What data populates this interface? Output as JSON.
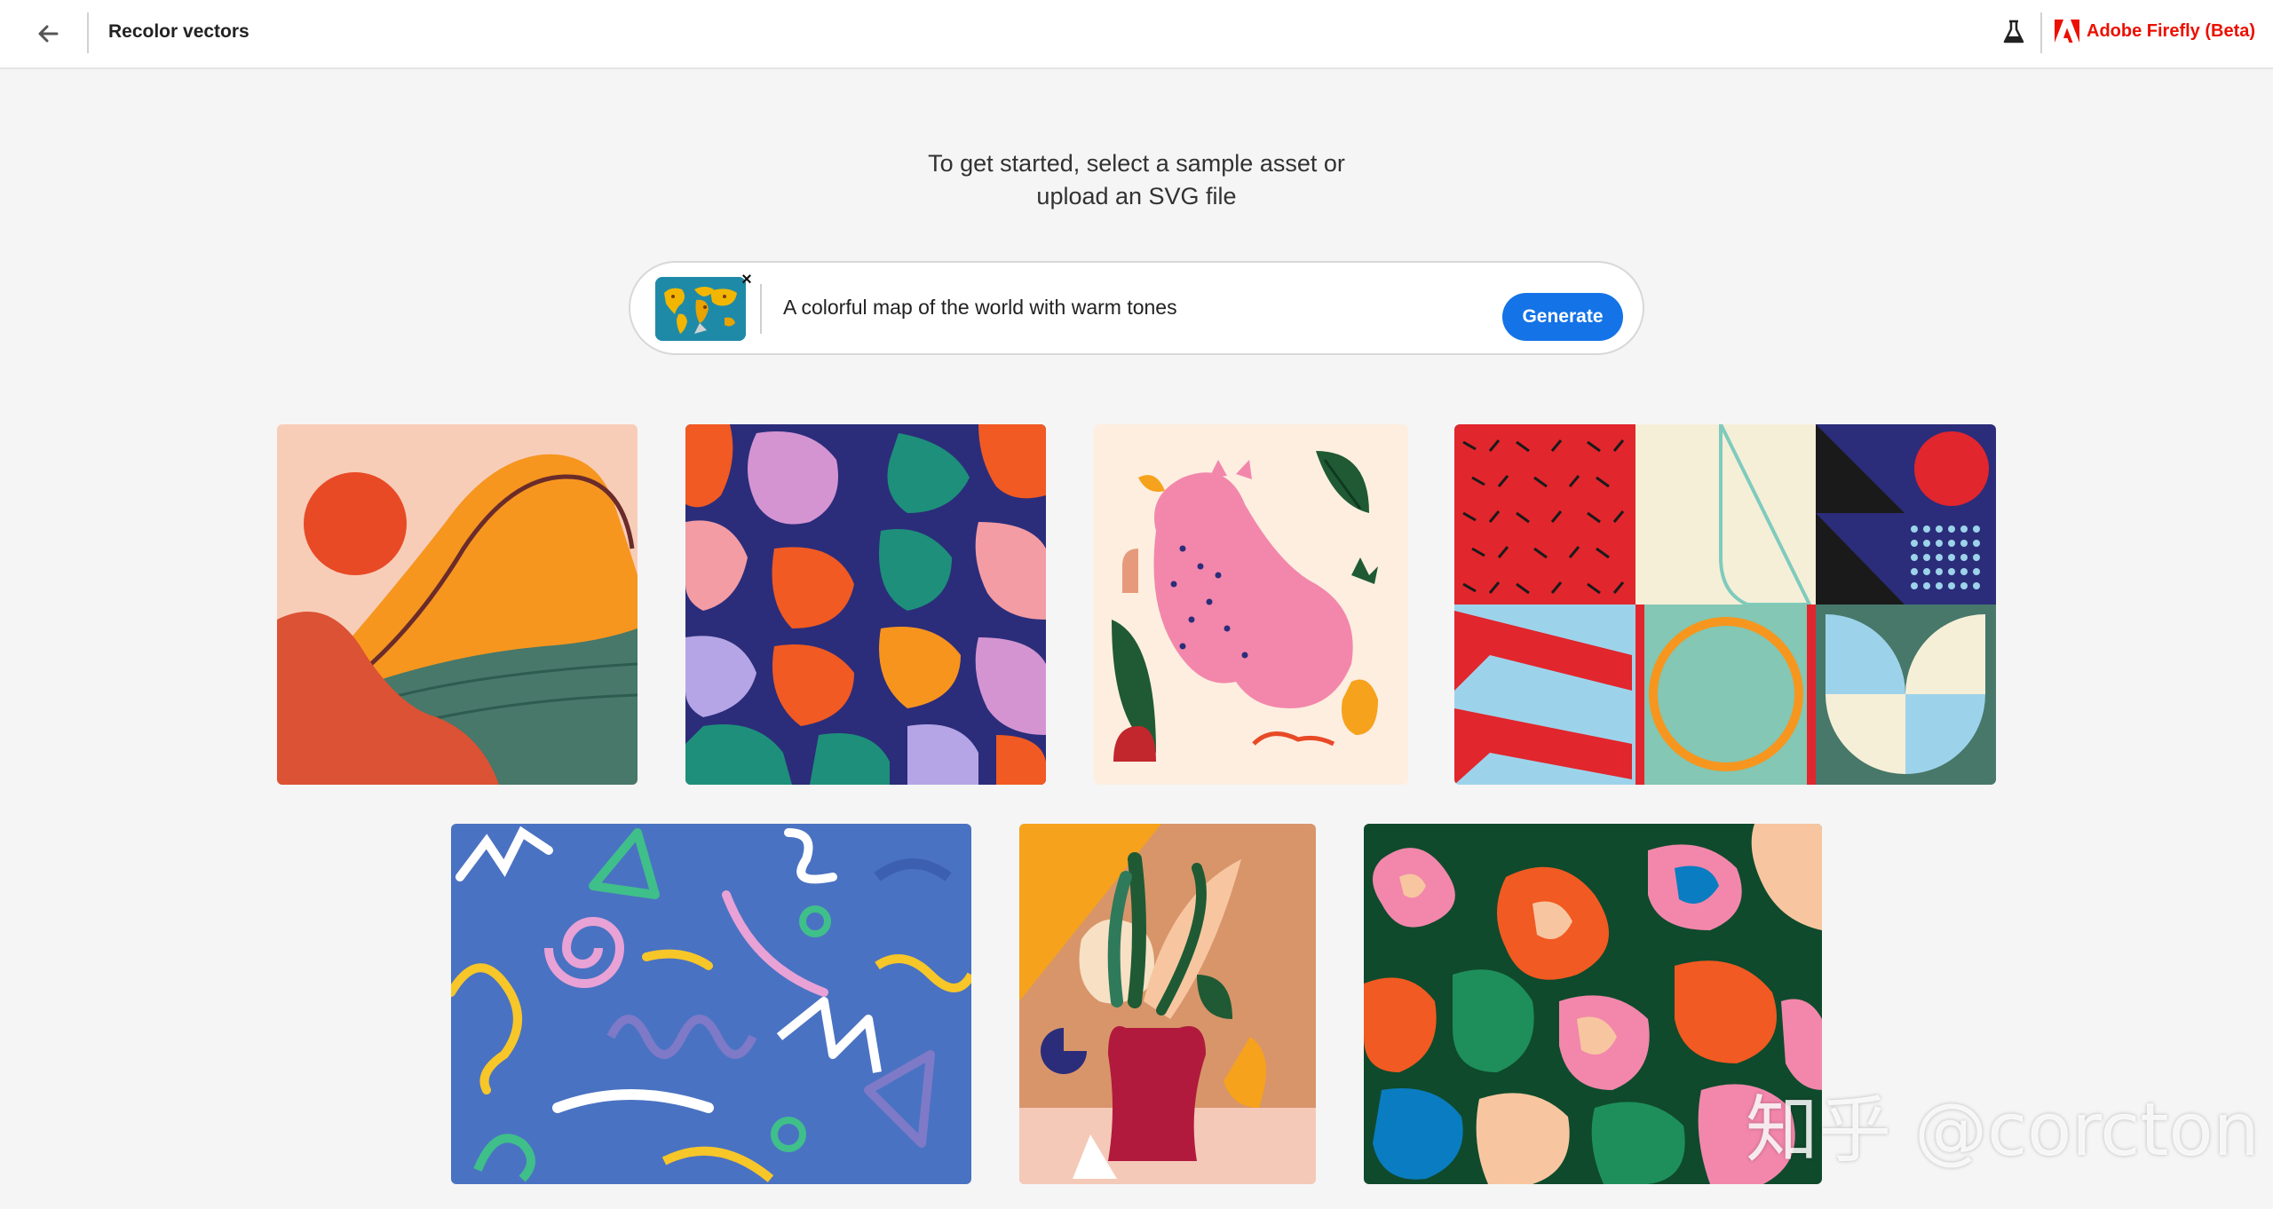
{
  "header": {
    "title": "Recolor vectors",
    "brand": "Adobe Firefly (Beta)",
    "back_icon": "arrow-left-icon",
    "lab_icon": "flask-icon",
    "brand_icon": "adobe-logo-icon",
    "brand_color": "#eb1000"
  },
  "intro": {
    "line1": "To get started, select a sample asset or",
    "line2": "upload an SVG file"
  },
  "prompt": {
    "value": "A colorful map of the world with warm tones",
    "generate_label": "Generate",
    "remove_symbol": "×",
    "accent": "#1473e6"
  },
  "samples": [
    {
      "name": "landscape-abstract"
    },
    {
      "name": "figures-pattern"
    },
    {
      "name": "pink-cat"
    },
    {
      "name": "geometric-tiles"
    },
    {
      "name": "squiggle-doodles"
    },
    {
      "name": "vase-plant"
    },
    {
      "name": "organic-blobs"
    }
  ],
  "watermark": "知乎 @corcton"
}
